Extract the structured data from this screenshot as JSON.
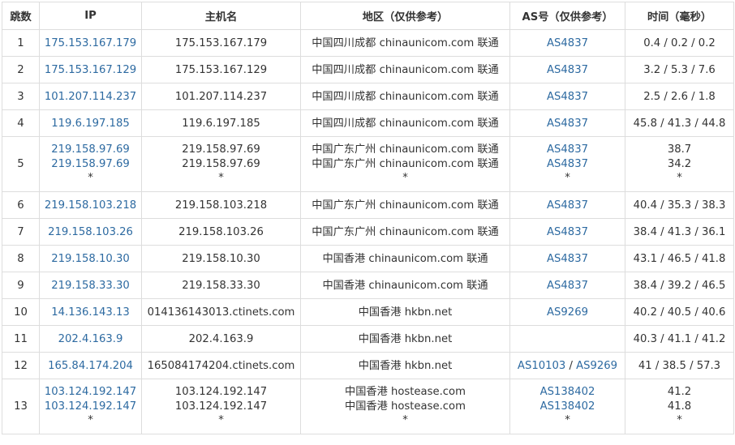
{
  "headers": {
    "hop": "跳数",
    "ip": "IP",
    "host": "主机名",
    "region": "地区（仅供参考）",
    "as": "AS号（仅供参考）",
    "time": "时间（毫秒）"
  },
  "rows": [
    {
      "hop": "1",
      "ips": [
        "175.153.167.179"
      ],
      "hosts": [
        "175.153.167.179"
      ],
      "regions": [
        "中国四川成都 chinaunicom.com 联通"
      ],
      "as": [
        [
          "AS4837"
        ]
      ],
      "times": [
        "0.4 / 0.2 / 0.2"
      ]
    },
    {
      "hop": "2",
      "ips": [
        "175.153.167.129"
      ],
      "hosts": [
        "175.153.167.129"
      ],
      "regions": [
        "中国四川成都 chinaunicom.com 联通"
      ],
      "as": [
        [
          "AS4837"
        ]
      ],
      "times": [
        "3.2 / 5.3 / 7.6"
      ]
    },
    {
      "hop": "3",
      "ips": [
        "101.207.114.237"
      ],
      "hosts": [
        "101.207.114.237"
      ],
      "regions": [
        "中国四川成都 chinaunicom.com 联通"
      ],
      "as": [
        [
          "AS4837"
        ]
      ],
      "times": [
        "2.5 / 2.6 / 1.8"
      ]
    },
    {
      "hop": "4",
      "ips": [
        "119.6.197.185"
      ],
      "hosts": [
        "119.6.197.185"
      ],
      "regions": [
        "中国四川成都 chinaunicom.com 联通"
      ],
      "as": [
        [
          "AS4837"
        ]
      ],
      "times": [
        "45.8 / 41.3 / 44.8"
      ]
    },
    {
      "hop": "5",
      "ips": [
        "219.158.97.69",
        "219.158.97.69",
        "*"
      ],
      "hosts": [
        "219.158.97.69",
        "219.158.97.69",
        "*"
      ],
      "regions": [
        "中国广东广州 chinaunicom.com 联通",
        "中国广东广州 chinaunicom.com 联通",
        "*"
      ],
      "as": [
        [
          "AS4837"
        ],
        [
          "AS4837"
        ],
        [
          "*"
        ]
      ],
      "times": [
        "38.7",
        "34.2",
        "*"
      ]
    },
    {
      "hop": "6",
      "ips": [
        "219.158.103.218"
      ],
      "hosts": [
        "219.158.103.218"
      ],
      "regions": [
        "中国广东广州 chinaunicom.com 联通"
      ],
      "as": [
        [
          "AS4837"
        ]
      ],
      "times": [
        "40.4 / 35.3 / 38.3"
      ]
    },
    {
      "hop": "7",
      "ips": [
        "219.158.103.26"
      ],
      "hosts": [
        "219.158.103.26"
      ],
      "regions": [
        "中国广东广州 chinaunicom.com 联通"
      ],
      "as": [
        [
          "AS4837"
        ]
      ],
      "times": [
        "38.4 / 41.3 / 36.1"
      ]
    },
    {
      "hop": "8",
      "ips": [
        "219.158.10.30"
      ],
      "hosts": [
        "219.158.10.30"
      ],
      "regions": [
        "中国香港 chinaunicom.com 联通"
      ],
      "as": [
        [
          "AS4837"
        ]
      ],
      "times": [
        "43.1 / 46.5 / 41.8"
      ]
    },
    {
      "hop": "9",
      "ips": [
        "219.158.33.30"
      ],
      "hosts": [
        "219.158.33.30"
      ],
      "regions": [
        "中国香港 chinaunicom.com 联通"
      ],
      "as": [
        [
          "AS4837"
        ]
      ],
      "times": [
        "38.4 / 39.2 / 46.5"
      ]
    },
    {
      "hop": "10",
      "ips": [
        "14.136.143.13"
      ],
      "hosts": [
        "014136143013.ctinets.com"
      ],
      "regions": [
        "中国香港 hkbn.net"
      ],
      "as": [
        [
          "AS9269"
        ]
      ],
      "times": [
        "40.2 / 40.5 / 40.6"
      ]
    },
    {
      "hop": "11",
      "ips": [
        "202.4.163.9"
      ],
      "hosts": [
        "202.4.163.9"
      ],
      "regions": [
        "中国香港 hkbn.net"
      ],
      "as": [
        []
      ],
      "times": [
        "40.3 / 41.1 / 41.2"
      ]
    },
    {
      "hop": "12",
      "ips": [
        "165.84.174.204"
      ],
      "hosts": [
        "165084174204.ctinets.com"
      ],
      "regions": [
        "中国香港 hkbn.net"
      ],
      "as": [
        [
          "AS10103",
          "AS9269"
        ]
      ],
      "times": [
        "41 / 38.5 / 57.3"
      ]
    },
    {
      "hop": "13",
      "ips": [
        "103.124.192.147",
        "103.124.192.147",
        "*"
      ],
      "hosts": [
        "103.124.192.147",
        "103.124.192.147",
        "*"
      ],
      "regions": [
        "中国香港 hostease.com",
        "中国香港 hostease.com",
        "*"
      ],
      "as": [
        [
          "AS138402"
        ],
        [
          "AS138402"
        ],
        [
          "*"
        ]
      ],
      "times": [
        "41.2",
        "41.8",
        "*"
      ]
    }
  ],
  "colors": {
    "link": "#2d6aa1",
    "text": "#333333",
    "border": "#dddddd"
  }
}
